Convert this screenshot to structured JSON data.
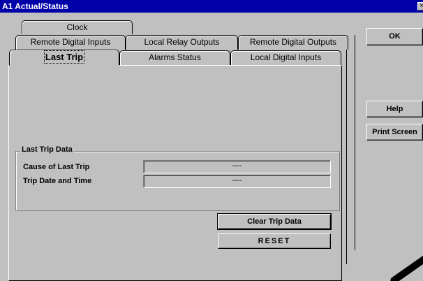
{
  "window": {
    "title": "A1 Actual/Status",
    "close_glyph": "×"
  },
  "tabs": {
    "row3": [
      {
        "label": "Clock"
      }
    ],
    "row2": [
      {
        "label": "Remote Digital Inputs"
      },
      {
        "label": "Local Relay Outputs"
      },
      {
        "label": "Remote Digital Outputs"
      }
    ],
    "row1": [
      {
        "label": "Last Trip",
        "active": true
      },
      {
        "label": "Alarms Status"
      },
      {
        "label": "Local Digital Inputs"
      }
    ]
  },
  "last_trip": {
    "group_label": "Last Trip Data",
    "cause_label": "Cause of Last Trip",
    "cause_value": "----",
    "datetime_label": "Trip Date and Time",
    "datetime_value": "----",
    "clear_button": "Clear Trip Data",
    "reset_button": "RESET"
  },
  "side_buttons": {
    "ok": "OK",
    "help": "Help",
    "print": "Print Screen"
  },
  "colors": {
    "title_bar": "#0000a8",
    "face": "#c0c0c0"
  }
}
